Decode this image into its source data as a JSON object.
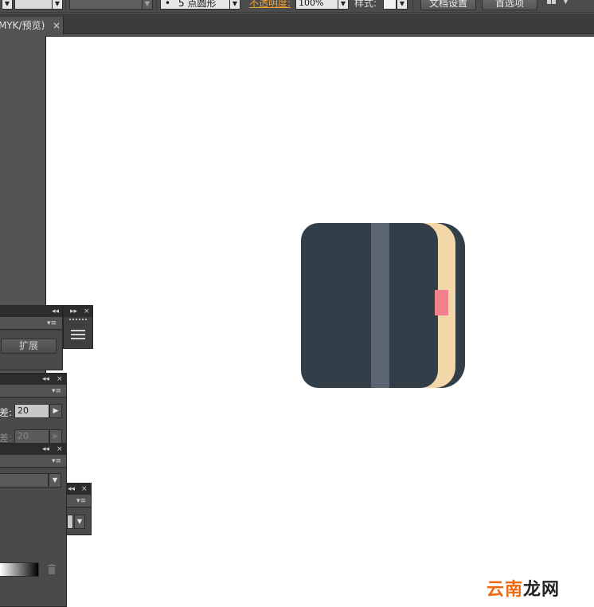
{
  "control_bar": {
    "brush_size_label": "5 点圆形",
    "brush_dot": "•",
    "opacity_label": "不透明度:",
    "opacity_value": "100%",
    "style_label": "样式:",
    "doc_setup_button": "文档设置",
    "preferences_button": "首选项"
  },
  "document_tab": {
    "title": "MYK/预览)",
    "close_glyph": "×"
  },
  "panels": {
    "collapse_glyph": "◂◂",
    "expand_glyph": "▸▸",
    "close_glyph": "×",
    "menu_glyph": "▾≡",
    "expand_button_label": "扩展",
    "tolerance_label": "差:",
    "tolerance_value": "20",
    "tolerance_disabled_label": "差:",
    "tolerance_disabled_value": "20"
  },
  "artwork": {
    "colors": {
      "cover": "#323E48",
      "cover_back": "#323E48",
      "pages": "#F3D7A9",
      "strap": "#5B6571",
      "bookmark": "#F0808A"
    }
  },
  "watermark": {
    "part1": "云南",
    "part2": "龙网"
  }
}
